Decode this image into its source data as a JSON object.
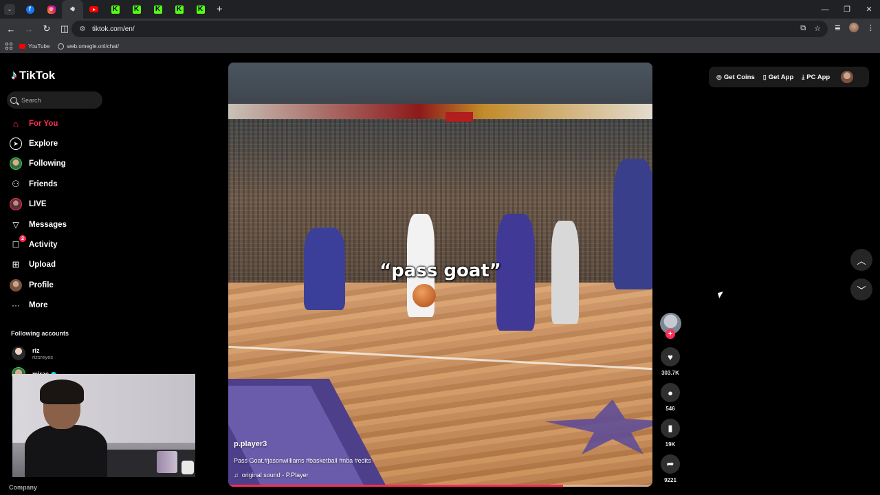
{
  "browser": {
    "url": "tiktok.com/en/",
    "tabs": [
      {
        "icon": "facebook-icon"
      },
      {
        "icon": "instagram-icon"
      },
      {
        "icon": "audio-playing-icon",
        "active": true
      },
      {
        "icon": "youtube-icon"
      },
      {
        "icon": "kick-icon"
      },
      {
        "icon": "kick-icon"
      },
      {
        "icon": "kick-icon"
      },
      {
        "icon": "kick-icon"
      },
      {
        "icon": "kick-icon"
      }
    ],
    "bookmarks": [
      {
        "label": "YouTube",
        "icon": "youtube-icon"
      },
      {
        "label": "web.omegle.onl/chat/",
        "icon": "globe-icon"
      }
    ]
  },
  "sidebar": {
    "logo": "TikTok",
    "search_placeholder": "Search",
    "nav": [
      {
        "label": "For You",
        "icon": "home-icon",
        "active": true
      },
      {
        "label": "Explore",
        "icon": "compass-icon"
      },
      {
        "label": "Following",
        "icon": "following-avatar-icon"
      },
      {
        "label": "Friends",
        "icon": "friends-icon"
      },
      {
        "label": "LIVE",
        "icon": "live-icon"
      },
      {
        "label": "Messages",
        "icon": "send-icon"
      },
      {
        "label": "Activity",
        "icon": "activity-icon",
        "badge": "2"
      },
      {
        "label": "Upload",
        "icon": "upload-icon"
      },
      {
        "label": "Profile",
        "icon": "profile-avatar-icon"
      },
      {
        "label": "More",
        "icon": "more-icon"
      }
    ],
    "following_title": "Following accounts",
    "accounts": [
      {
        "name": "riz",
        "username": "rizsreyes"
      },
      {
        "name": "mirae",
        "verified": true
      }
    ],
    "footer": "Company"
  },
  "video": {
    "overlay_caption": "“pass goat”",
    "author": "p.player3",
    "description": "Pass Goat.#jasonwilliams #basketball #nba #edits",
    "sound": "original sound - P.Player",
    "progress_fraction": 0.79
  },
  "actions": {
    "likes": "303.7K",
    "comments": "546",
    "saves": "19K",
    "shares": "9221"
  },
  "top_right": {
    "get_coins": "Get Coins",
    "get_app": "Get App",
    "pc_app": "PC App"
  }
}
